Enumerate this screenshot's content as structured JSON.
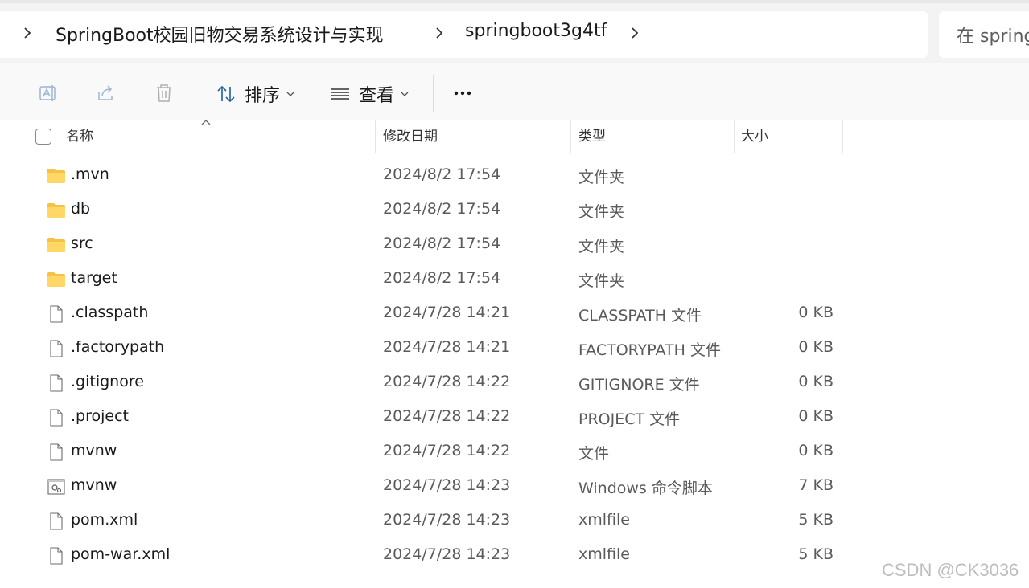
{
  "address": {
    "crumbs": [
      "SpringBoot校园旧物交易系统设计与实现",
      "springboot3g4tf"
    ],
    "search_placeholder": "在 spring"
  },
  "toolbar": {
    "rename_icon": "rename-icon",
    "share_icon": "share-icon",
    "delete_icon": "trash-icon",
    "sort_label": "排序",
    "view_label": "查看",
    "more_label": "···"
  },
  "columns": {
    "name": "名称",
    "date": "修改日期",
    "type": "类型",
    "size": "大小"
  },
  "files": [
    {
      "icon": "folder-icon",
      "name": ".mvn",
      "date": "2024/8/2 17:54",
      "type": "文件夹",
      "size": ""
    },
    {
      "icon": "folder-icon",
      "name": "db",
      "date": "2024/8/2 17:54",
      "type": "文件夹",
      "size": ""
    },
    {
      "icon": "folder-icon",
      "name": "src",
      "date": "2024/8/2 17:54",
      "type": "文件夹",
      "size": ""
    },
    {
      "icon": "folder-icon",
      "name": "target",
      "date": "2024/8/2 17:54",
      "type": "文件夹",
      "size": ""
    },
    {
      "icon": "file-icon",
      "name": ".classpath",
      "date": "2024/7/28 14:21",
      "type": "CLASSPATH 文件",
      "size": "0 KB"
    },
    {
      "icon": "file-icon",
      "name": ".factorypath",
      "date": "2024/7/28 14:21",
      "type": "FACTORYPATH 文件",
      "size": "0 KB"
    },
    {
      "icon": "file-icon",
      "name": ".gitignore",
      "date": "2024/7/28 14:22",
      "type": "GITIGNORE 文件",
      "size": "0 KB"
    },
    {
      "icon": "file-icon",
      "name": ".project",
      "date": "2024/7/28 14:22",
      "type": "PROJECT 文件",
      "size": "0 KB"
    },
    {
      "icon": "file-icon",
      "name": "mvnw",
      "date": "2024/7/28 14:22",
      "type": "文件",
      "size": "0 KB"
    },
    {
      "icon": "script-file-icon",
      "name": "mvnw",
      "date": "2024/7/28 14:23",
      "type": "Windows 命令脚本",
      "size": "7 KB"
    },
    {
      "icon": "file-icon",
      "name": "pom.xml",
      "date": "2024/7/28 14:23",
      "type": "xmlfile",
      "size": "5 KB"
    },
    {
      "icon": "file-icon",
      "name": "pom-war.xml",
      "date": "2024/7/28 14:23",
      "type": "xmlfile",
      "size": "5 KB"
    }
  ],
  "watermark": "CSDN @CK3036"
}
